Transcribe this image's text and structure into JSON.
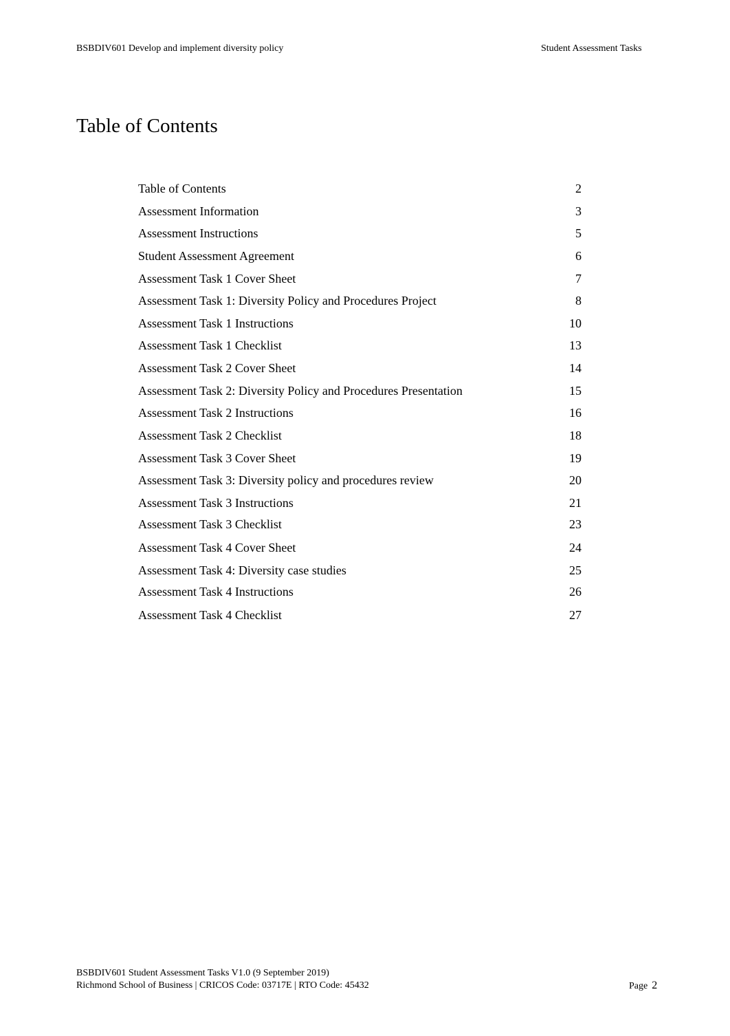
{
  "header": {
    "left": "BSBDIV601 Develop and implement diversity policy",
    "right": "Student Assessment Tasks"
  },
  "title": "Table of Contents",
  "toc": [
    {
      "label": "Table of Contents",
      "page": "2"
    },
    {
      "label": "Assessment Information",
      "page": "3"
    },
    {
      "label": "Assessment Instructions",
      "page": "5"
    },
    {
      "label": "Student Assessment Agreement",
      "page": "6"
    },
    {
      "label": "Assessment Task 1 Cover Sheet",
      "page": "7"
    },
    {
      "label": "Assessment Task 1: Diversity Policy and Procedures Project",
      "page": "8"
    },
    {
      "label": "Assessment Task 1 Instructions",
      "page": "10"
    },
    {
      "label": "Assessment Task 1 Checklist",
      "page": "13"
    },
    {
      "label": "Assessment Task 2 Cover Sheet",
      "page": "14"
    },
    {
      "label": "Assessment Task 2: Diversity Policy and Procedures Presentation",
      "page": "15"
    },
    {
      "label": "Assessment Task 2 Instructions",
      "page": "16"
    },
    {
      "label": "Assessment Task 2 Checklist",
      "page": "18"
    },
    {
      "label": "Assessment Task 3 Cover Sheet",
      "page": "19"
    },
    {
      "label": "Assessment Task 3: Diversity policy and procedures review",
      "page": "20"
    },
    {
      "label": "Assessment Task 3 Instructions",
      "page": "21"
    },
    {
      "label": "Assessment Task 3 Checklist",
      "page": "23"
    },
    {
      "label": "Assessment Task 4 Cover Sheet",
      "page": "24"
    },
    {
      "label": "Assessment Task 4: Diversity case studies",
      "page": "25"
    },
    {
      "label": "Assessment Task 4 Instructions",
      "page": "26"
    },
    {
      "label": "Assessment Task 4 Checklist",
      "page": "27"
    }
  ],
  "footer": {
    "line1": "BSBDIV601 Student Assessment Tasks V1.0 (9 September 2019)",
    "line2": "Richmond School of Business | CRICOS Code: 03717E | RTO Code: 45432",
    "page_label": "Page",
    "page_number": "2"
  }
}
